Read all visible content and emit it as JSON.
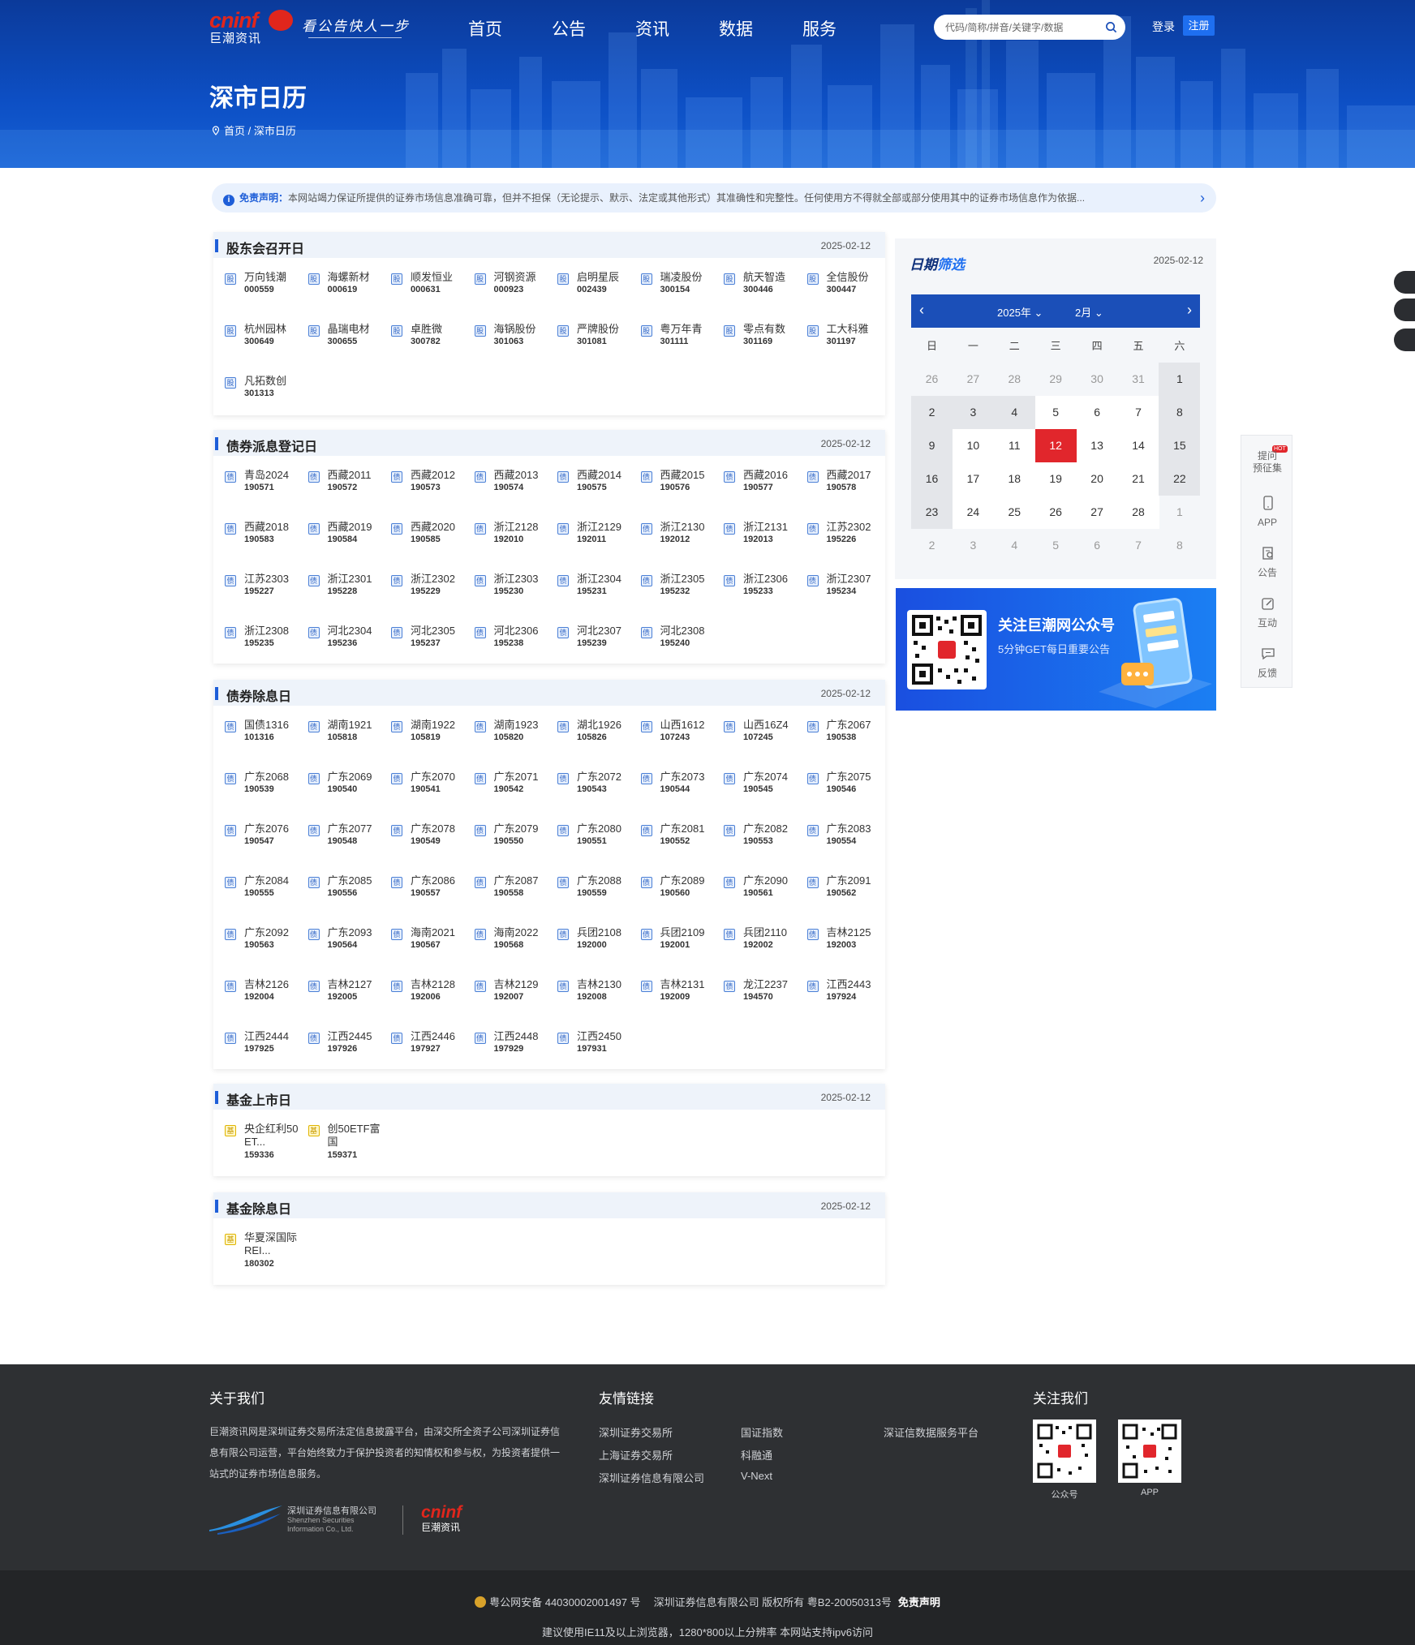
{
  "header": {
    "logo_en": "cninf",
    "logo_cn": "巨潮资讯",
    "slogan": "看公告快人一步",
    "nav": [
      "首页",
      "公告",
      "资讯",
      "数据",
      "服务"
    ],
    "search_placeholder": "代码/简称/拼音/关键字/数据",
    "login": "登录",
    "register": "注册",
    "page_title": "深市日历",
    "breadcrumb": "首页 / 深市日历"
  },
  "disclaimer": {
    "label": "免责声明：",
    "text": "本网站竭力保证所提供的证券市场信息准确可靠，但并不担保（无论提示、默示、法定或其他形式）其准确性和完整性。任何使用方不得就全部或部分使用其中的证券市场信息作为依据..."
  },
  "sections": [
    {
      "title": "股东会召开日",
      "date": "2025-02-12",
      "icon": "股",
      "items": [
        {
          "name": "万向钱潮",
          "code": "000559"
        },
        {
          "name": "海螺新材",
          "code": "000619"
        },
        {
          "name": "顺发恒业",
          "code": "000631"
        },
        {
          "name": "河钢资源",
          "code": "000923"
        },
        {
          "name": "启明星辰",
          "code": "002439"
        },
        {
          "name": "瑞凌股份",
          "code": "300154"
        },
        {
          "name": "航天智造",
          "code": "300446"
        },
        {
          "name": "全信股份",
          "code": "300447"
        },
        {
          "name": "杭州园林",
          "code": "300649"
        },
        {
          "name": "晶瑞电材",
          "code": "300655"
        },
        {
          "name": "卓胜微",
          "code": "300782"
        },
        {
          "name": "海锅股份",
          "code": "301063"
        },
        {
          "name": "严牌股份",
          "code": "301081"
        },
        {
          "name": "粤万年青",
          "code": "301111"
        },
        {
          "name": "零点有数",
          "code": "301169"
        },
        {
          "name": "工大科雅",
          "code": "301197"
        },
        {
          "name": "凡拓数创",
          "code": "301313"
        }
      ]
    },
    {
      "title": "债券派息登记日",
      "date": "2025-02-12",
      "icon": "债",
      "items": [
        {
          "name": "青岛2024",
          "code": "190571"
        },
        {
          "name": "西藏2011",
          "code": "190572"
        },
        {
          "name": "西藏2012",
          "code": "190573"
        },
        {
          "name": "西藏2013",
          "code": "190574"
        },
        {
          "name": "西藏2014",
          "code": "190575"
        },
        {
          "name": "西藏2015",
          "code": "190576"
        },
        {
          "name": "西藏2016",
          "code": "190577"
        },
        {
          "name": "西藏2017",
          "code": "190578"
        },
        {
          "name": "西藏2018",
          "code": "190583"
        },
        {
          "name": "西藏2019",
          "code": "190584"
        },
        {
          "name": "西藏2020",
          "code": "190585"
        },
        {
          "name": "浙江2128",
          "code": "192010"
        },
        {
          "name": "浙江2129",
          "code": "192011"
        },
        {
          "name": "浙江2130",
          "code": "192012"
        },
        {
          "name": "浙江2131",
          "code": "192013"
        },
        {
          "name": "江苏2302",
          "code": "195226"
        },
        {
          "name": "江苏2303",
          "code": "195227"
        },
        {
          "name": "浙江2301",
          "code": "195228"
        },
        {
          "name": "浙江2302",
          "code": "195229"
        },
        {
          "name": "浙江2303",
          "code": "195230"
        },
        {
          "name": "浙江2304",
          "code": "195231"
        },
        {
          "name": "浙江2305",
          "code": "195232"
        },
        {
          "name": "浙江2306",
          "code": "195233"
        },
        {
          "name": "浙江2307",
          "code": "195234"
        },
        {
          "name": "浙江2308",
          "code": "195235"
        },
        {
          "name": "河北2304",
          "code": "195236"
        },
        {
          "name": "河北2305",
          "code": "195237"
        },
        {
          "name": "河北2306",
          "code": "195238"
        },
        {
          "name": "河北2307",
          "code": "195239"
        },
        {
          "name": "河北2308",
          "code": "195240"
        }
      ]
    },
    {
      "title": "债券除息日",
      "date": "2025-02-12",
      "icon": "债",
      "items": [
        {
          "name": "国债1316",
          "code": "101316"
        },
        {
          "name": "湖南1921",
          "code": "105818"
        },
        {
          "name": "湖南1922",
          "code": "105819"
        },
        {
          "name": "湖南1923",
          "code": "105820"
        },
        {
          "name": "湖北1926",
          "code": "105826"
        },
        {
          "name": "山西1612",
          "code": "107243"
        },
        {
          "name": "山西16Z4",
          "code": "107245"
        },
        {
          "name": "广东2067",
          "code": "190538"
        },
        {
          "name": "广东2068",
          "code": "190539"
        },
        {
          "name": "广东2069",
          "code": "190540"
        },
        {
          "name": "广东2070",
          "code": "190541"
        },
        {
          "name": "广东2071",
          "code": "190542"
        },
        {
          "name": "广东2072",
          "code": "190543"
        },
        {
          "name": "广东2073",
          "code": "190544"
        },
        {
          "name": "广东2074",
          "code": "190545"
        },
        {
          "name": "广东2075",
          "code": "190546"
        },
        {
          "name": "广东2076",
          "code": "190547"
        },
        {
          "name": "广东2077",
          "code": "190548"
        },
        {
          "name": "广东2078",
          "code": "190549"
        },
        {
          "name": "广东2079",
          "code": "190550"
        },
        {
          "name": "广东2080",
          "code": "190551"
        },
        {
          "name": "广东2081",
          "code": "190552"
        },
        {
          "name": "广东2082",
          "code": "190553"
        },
        {
          "name": "广东2083",
          "code": "190554"
        },
        {
          "name": "广东2084",
          "code": "190555"
        },
        {
          "name": "广东2085",
          "code": "190556"
        },
        {
          "name": "广东2086",
          "code": "190557"
        },
        {
          "name": "广东2087",
          "code": "190558"
        },
        {
          "name": "广东2088",
          "code": "190559"
        },
        {
          "name": "广东2089",
          "code": "190560"
        },
        {
          "name": "广东2090",
          "code": "190561"
        },
        {
          "name": "广东2091",
          "code": "190562"
        },
        {
          "name": "广东2092",
          "code": "190563"
        },
        {
          "name": "广东2093",
          "code": "190564"
        },
        {
          "name": "海南2021",
          "code": "190567"
        },
        {
          "name": "海南2022",
          "code": "190568"
        },
        {
          "name": "兵团2108",
          "code": "192000"
        },
        {
          "name": "兵团2109",
          "code": "192001"
        },
        {
          "name": "兵团2110",
          "code": "192002"
        },
        {
          "name": "吉林2125",
          "code": "192003"
        },
        {
          "name": "吉林2126",
          "code": "192004"
        },
        {
          "name": "吉林2127",
          "code": "192005"
        },
        {
          "name": "吉林2128",
          "code": "192006"
        },
        {
          "name": "吉林2129",
          "code": "192007"
        },
        {
          "name": "吉林2130",
          "code": "192008"
        },
        {
          "name": "吉林2131",
          "code": "192009"
        },
        {
          "name": "龙江2237",
          "code": "194570"
        },
        {
          "name": "江西2443",
          "code": "197924"
        },
        {
          "name": "江西2444",
          "code": "197925"
        },
        {
          "name": "江西2445",
          "code": "197926"
        },
        {
          "name": "江西2446",
          "code": "197927"
        },
        {
          "name": "江西2448",
          "code": "197929"
        },
        {
          "name": "江西2450",
          "code": "197931"
        }
      ]
    },
    {
      "title": "基金上市日",
      "date": "2025-02-12",
      "icon": "基",
      "items": [
        {
          "name": "央企红利50ET...",
          "code": "159336"
        },
        {
          "name": "创50ETF富国",
          "code": "159371"
        }
      ]
    },
    {
      "title": "基金除息日",
      "date": "2025-02-12",
      "icon": "基",
      "items": [
        {
          "name": "华夏深国际REI...",
          "code": "180302"
        }
      ]
    }
  ],
  "calendar": {
    "title_a": "日期",
    "title_b": "筛选",
    "date": "2025-02-12",
    "year": "2025年",
    "month": "2月",
    "weekdays": [
      "日",
      "一",
      "二",
      "三",
      "四",
      "五",
      "六"
    ],
    "weeks": [
      [
        "26",
        "27",
        "28",
        "29",
        "30",
        "31",
        "1"
      ],
      [
        "2",
        "3",
        "4",
        "5",
        "6",
        "7",
        "8"
      ],
      [
        "9",
        "10",
        "11",
        "12",
        "13",
        "14",
        "15"
      ],
      [
        "16",
        "17",
        "18",
        "19",
        "20",
        "21",
        "22"
      ],
      [
        "23",
        "24",
        "25",
        "26",
        "27",
        "28",
        "1"
      ],
      [
        "2",
        "3",
        "4",
        "5",
        "6",
        "7",
        "8"
      ]
    ],
    "selected": "12"
  },
  "banner": {
    "title": "关注巨潮网公众号",
    "subtitle": "5分钟GET每日重要公告"
  },
  "tools": [
    {
      "label": "提问\n预征集",
      "icon": "question-icon",
      "hot": "HOT"
    },
    {
      "label": "APP",
      "icon": "phone-icon"
    },
    {
      "label": "公告",
      "icon": "notice-icon"
    },
    {
      "label": "互动",
      "icon": "edit-icon"
    },
    {
      "label": "反馈",
      "icon": "chat-icon"
    }
  ],
  "footer": {
    "about_title": "关于我们",
    "about_text": "巨潮资讯网是深圳证券交易所法定信息披露平台，由深交所全资子公司深圳证券信息有限公司运营，平台始终致力于保护投资者的知情权和参与权，为投资者提供一站式的证券市场信息服务。",
    "links_title": "友情链接",
    "links": [
      "深圳证券交易所",
      "上海证券交易所",
      "深圳证券信息有限公司",
      "国证指数",
      "科融通",
      "V-Next",
      "深证信数据服务平台"
    ],
    "follow_title": "关注我们",
    "qr_labels": [
      "公众号",
      "APP"
    ],
    "company_cn": "深圳证券信息有限公司",
    "company_en1": "Shenzhen Securities",
    "company_en2": "Information Co., Ltd.",
    "logo_en": "cninf",
    "logo_cn": "巨潮资讯",
    "icp": "粤公网安备 44030002001497 号",
    "copyright": "深圳证券信息有限公司 版权所有 粤B2-20050313号",
    "disclaimer_link": "免责声明",
    "browser_note": "建议使用IE11及以上浏览器，1280*800以上分辨率 本网站支持ipv6访问"
  },
  "colors": {
    "brand_blue": "#1b4fb8",
    "accent_red": "#e1262c",
    "header_blue": "#0d4fc4"
  }
}
